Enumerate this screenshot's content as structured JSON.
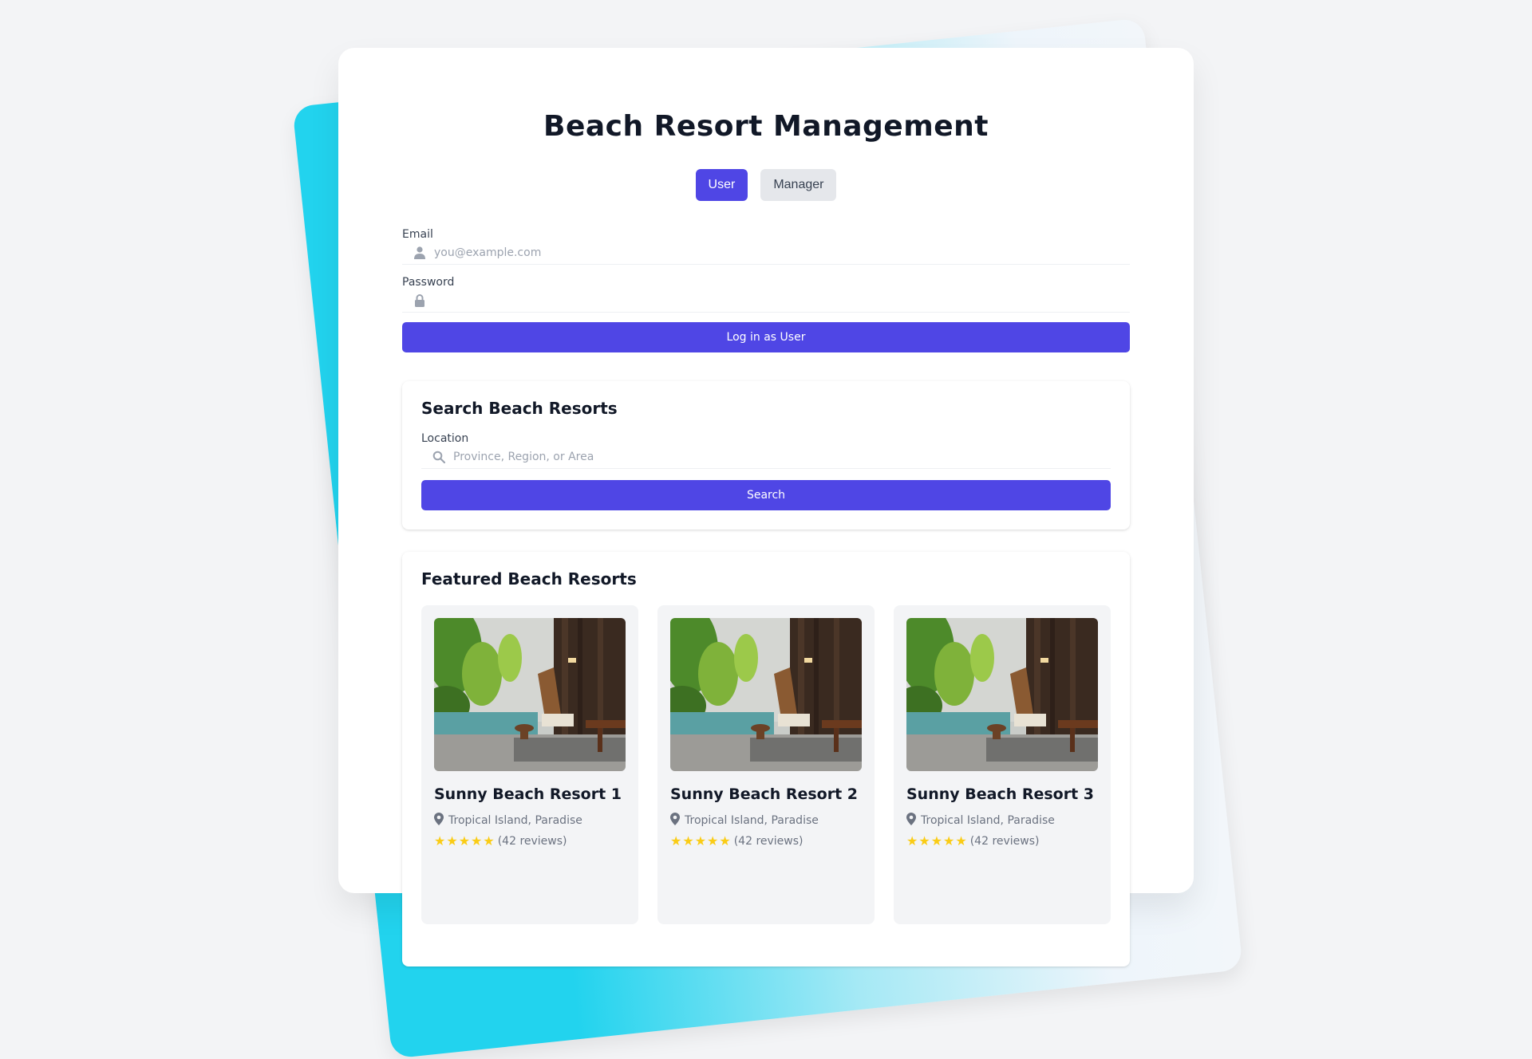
{
  "app": {
    "title": "Beach Resort Management"
  },
  "roles": {
    "user_label": "User",
    "manager_label": "Manager",
    "selected": "User"
  },
  "login": {
    "email_label": "Email",
    "email_placeholder": "you@example.com",
    "email_value": "",
    "password_label": "Password",
    "password_value": "",
    "submit_label": "Log in as User"
  },
  "search": {
    "title": "Search Beach Resorts",
    "location_label": "Location",
    "location_placeholder": "Province, Region, or Area",
    "location_value": "",
    "submit_label": "Search"
  },
  "featured": {
    "title": "Featured Beach Resorts",
    "resorts": [
      {
        "name": "Sunny Beach Resort 1",
        "location": "Tropical Island, Paradise",
        "stars": 5,
        "reviews": "(42 reviews)"
      },
      {
        "name": "Sunny Beach Resort 2",
        "location": "Tropical Island, Paradise",
        "stars": 5,
        "reviews": "(42 reviews)"
      },
      {
        "name": "Sunny Beach Resort 3",
        "location": "Tropical Island, Paradise",
        "stars": 5,
        "reviews": "(42 reviews)"
      }
    ]
  },
  "colors": {
    "accent": "#4f46e5",
    "background_card": "#22d3ee",
    "star": "#facc15"
  },
  "icons": {
    "email": "user-icon",
    "password": "lock-icon",
    "location": "search-icon",
    "resort_location": "map-pin-icon",
    "rating": "star-icon"
  }
}
